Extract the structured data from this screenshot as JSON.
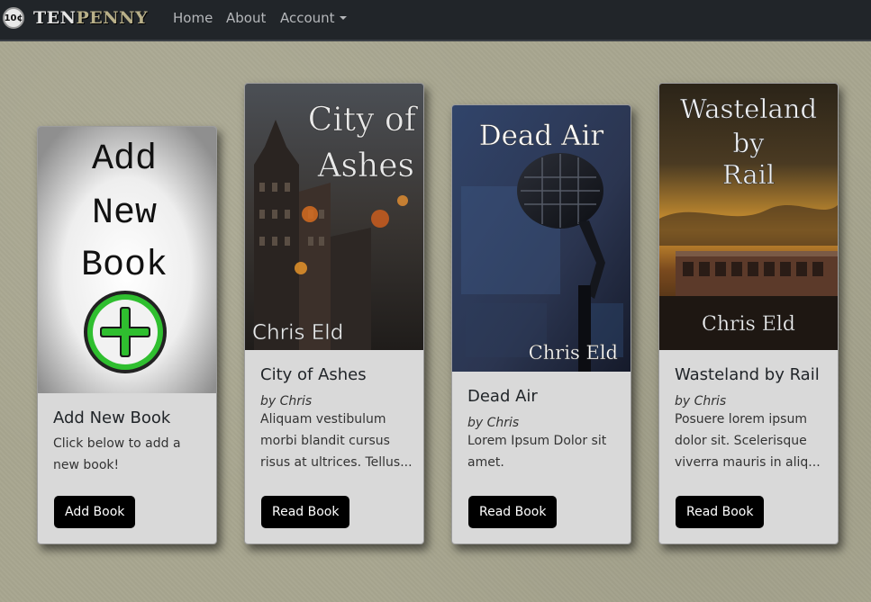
{
  "navbar": {
    "logo_coin": "10¢",
    "brand_ten": "TEN",
    "brand_penny": "PENNY",
    "links": [
      {
        "label": "Home"
      },
      {
        "label": "About"
      },
      {
        "label": "Account"
      }
    ]
  },
  "cards": [
    {
      "cover_text": [
        "Add",
        "New",
        "Book"
      ],
      "cover_icon": "plus-circle-icon",
      "title": "Add New Book",
      "text": "Click below to add a new book!",
      "button": "Add Book"
    },
    {
      "cover_title": [
        "City of",
        "Ashes"
      ],
      "cover_author": "Chris Eld",
      "title": "City of Ashes",
      "author": "by Chris",
      "text": "Aliquam vestibulum morbi blandit cursus risus at ultrices. Tellus...",
      "button": "Read Book"
    },
    {
      "cover_title": [
        "Dead Air"
      ],
      "cover_author": "Chris Eld",
      "title": "Dead Air",
      "author": "by Chris",
      "text": "Lorem Ipsum Dolor sit amet.",
      "button": "Read Book"
    },
    {
      "cover_title": [
        "Wasteland",
        "by",
        "Rail"
      ],
      "cover_author": "Chris Eld",
      "title": "Wasteland by Rail",
      "author": "by Chris",
      "text": "Posuere lorem ipsum dolor sit. Scelerisque viverra mauris in aliq...",
      "button": "Read Book"
    }
  ],
  "colors": {
    "navbar_bg": "#212529",
    "page_bg": "#a8a690",
    "card_bg": "#d9d9d9",
    "button_bg": "#000000",
    "plus_green": "#22a022"
  }
}
